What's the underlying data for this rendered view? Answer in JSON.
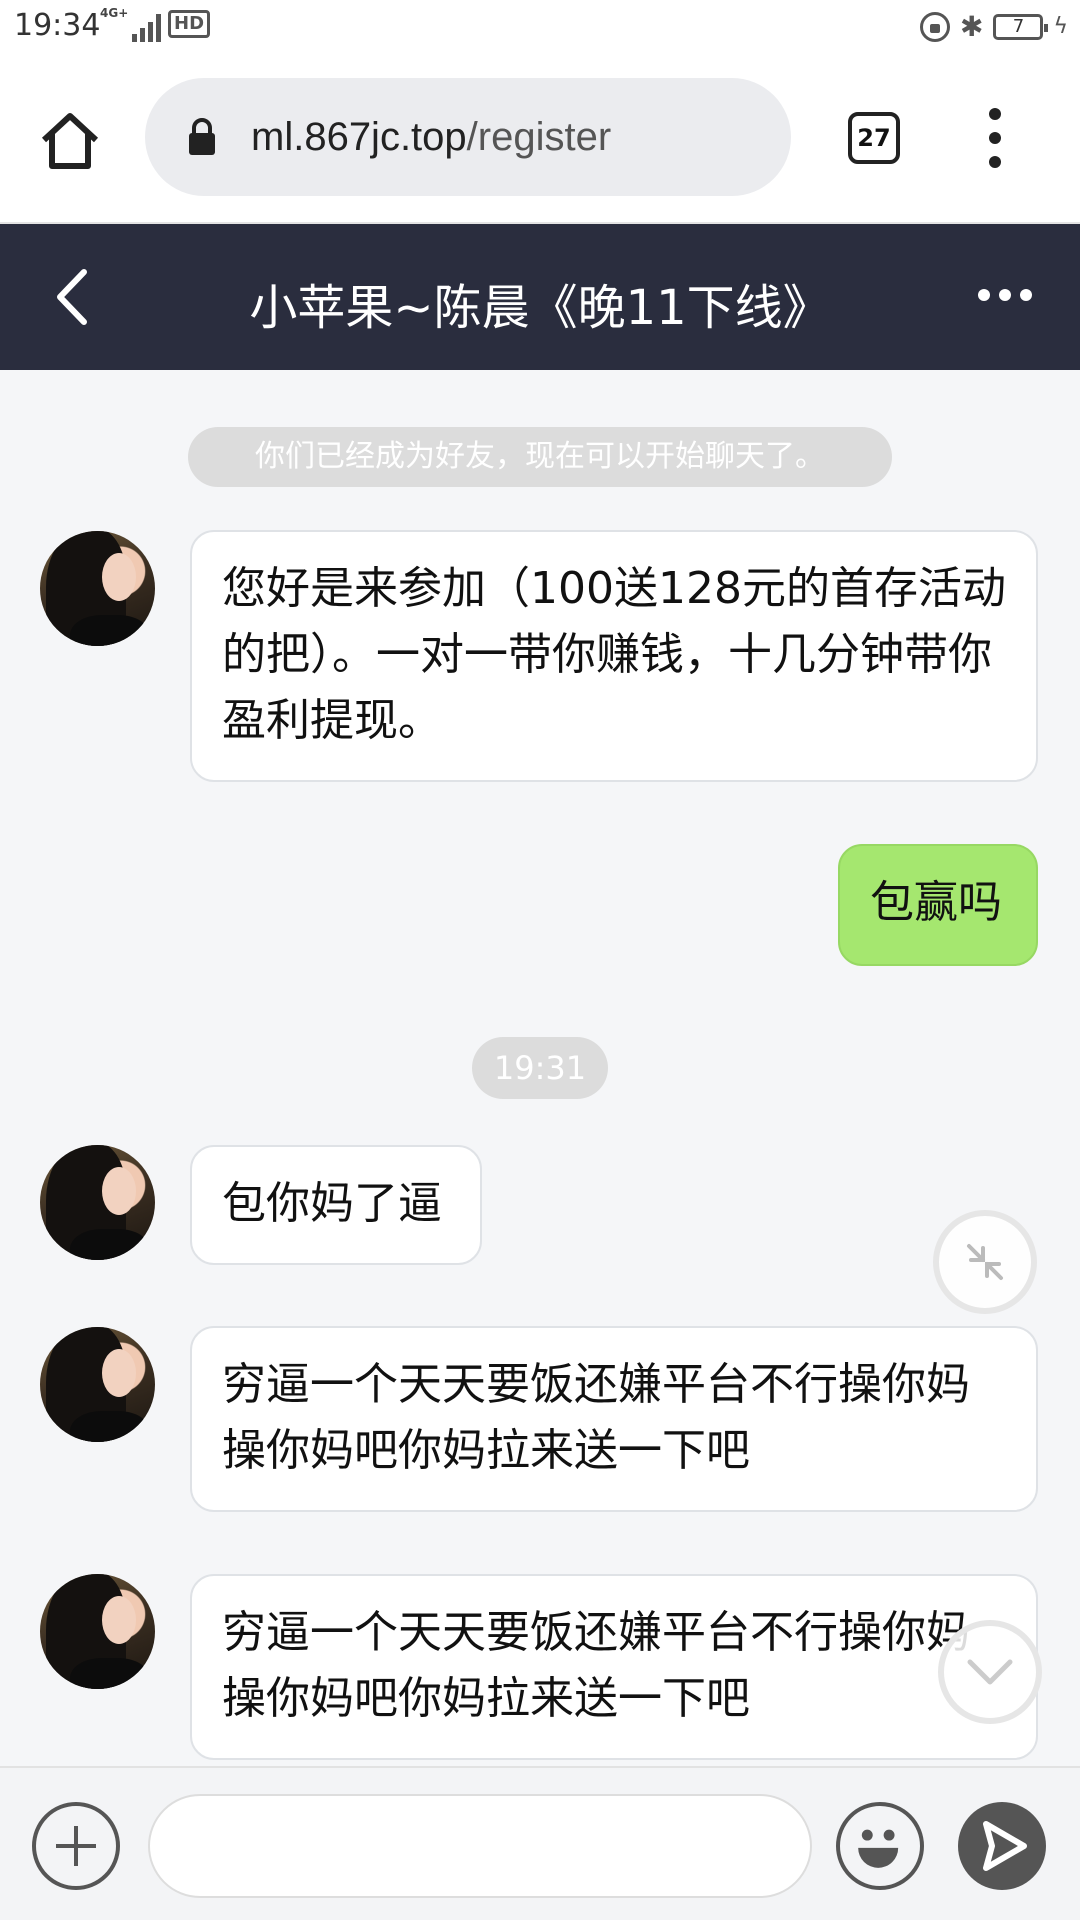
{
  "status_bar": {
    "time": "19:34",
    "network": "4G+",
    "hd": "HD",
    "battery": "7"
  },
  "browser": {
    "url_domain": "ml.867jc.top",
    "url_path": "/register",
    "tab_count": "27",
    "icons": [
      "home-icon",
      "lock-icon",
      "tabs-icon",
      "more-vert-icon"
    ]
  },
  "chat": {
    "title": "小苹果~陈晨《晚11下线》",
    "system_note": "你们已经成为好友，现在可以开始聊天了。",
    "time_divider": "19:31",
    "messages": [
      {
        "sender": "other",
        "text": "您好是来参加（100送128元的首存活动的把）。一对一带你赚钱，十几分钟带你盈利提现。"
      },
      {
        "sender": "me",
        "text": "包赢吗"
      },
      {
        "sender": "other",
        "text": "包你妈了逼"
      },
      {
        "sender": "other",
        "text": "穷逼一个天天要饭还嫌平台不行操你妈操你妈吧你妈拉来送一下吧"
      },
      {
        "sender": "other",
        "text": "穷逼一个天天要饭还嫌平台不行操你妈操你妈吧你妈拉来送一下吧"
      }
    ]
  },
  "input": {
    "value": "",
    "placeholder": ""
  }
}
